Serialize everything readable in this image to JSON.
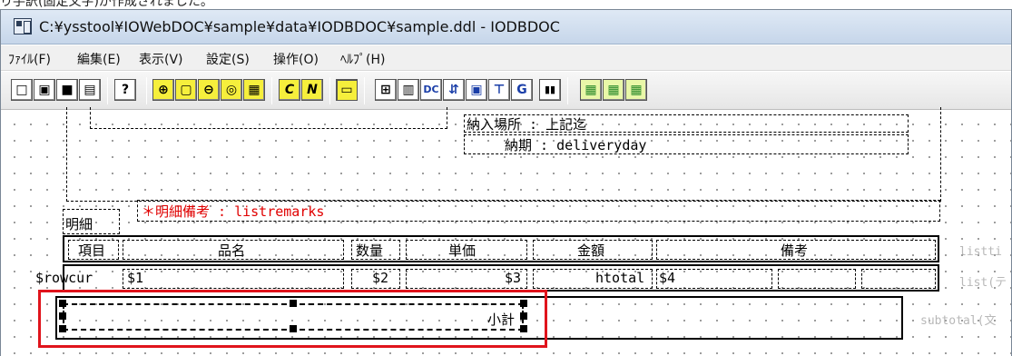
{
  "caption": "り手訳(固定文字)が作成されました。",
  "window": {
    "title": "C:¥ysstool¥IOWebDOC¥sample¥data¥IODBDOC¥sample.ddl - IODBDOC"
  },
  "menu": {
    "items": [
      "ﾌｧｲﾙ(F)",
      "編集(E)",
      "表示(V)",
      "設定(S)",
      "操作(O)",
      "ﾍﾙﾌﾟ(H)"
    ]
  },
  "toolbar": {
    "buttons": [
      {
        "name": "new",
        "glyph": "□"
      },
      {
        "name": "open",
        "glyph": "▣"
      },
      {
        "name": "save",
        "glyph": "■"
      },
      {
        "name": "preview",
        "glyph": "▤"
      },
      {
        "name": "help",
        "glyph": "?"
      },
      {
        "name": "zoom-in",
        "glyph": "⊕"
      },
      {
        "name": "page",
        "glyph": "▢"
      },
      {
        "name": "zoom-out",
        "glyph": "⊖"
      },
      {
        "name": "zoom-fit",
        "glyph": "◎"
      },
      {
        "name": "grid",
        "glyph": "▦"
      },
      {
        "name": "italic",
        "glyph": "C"
      },
      {
        "name": "bold",
        "glyph": "N"
      },
      {
        "name": "field",
        "glyph": "▭"
      },
      {
        "name": "insert-box",
        "glyph": "⊞"
      },
      {
        "name": "table",
        "glyph": "▥"
      },
      {
        "name": "dc",
        "glyph": "DC"
      },
      {
        "name": "align",
        "glyph": "⇵"
      },
      {
        "name": "window",
        "glyph": "▣"
      },
      {
        "name": "tree",
        "glyph": "⊤"
      },
      {
        "name": "graphic",
        "glyph": "G"
      },
      {
        "name": "barcode",
        "glyph": "▮▮"
      },
      {
        "name": "layout-1",
        "glyph": "▦"
      },
      {
        "name": "layout-2",
        "glyph": "▦"
      },
      {
        "name": "layout-3",
        "glyph": "▦"
      }
    ]
  },
  "report": {
    "delivery_place": "納入場所 : 上記迄",
    "delivery_date": "納期 : deliveryday",
    "remarks": "＊明細備考 : listremarks",
    "detail_label": "明細",
    "headers": [
      "項目",
      "品名",
      "数量",
      "単価",
      "金額",
      "備考"
    ],
    "row": [
      "$rowcur",
      "$1",
      "$2",
      "$3",
      "htotal",
      "$4"
    ],
    "subtotal_label": "小計",
    "side_labels": [
      "listti",
      "list(テ",
      "subtotal(文"
    ]
  },
  "colors": {
    "selection_outline": "#e0141c",
    "remarks_text": "#e00000"
  }
}
